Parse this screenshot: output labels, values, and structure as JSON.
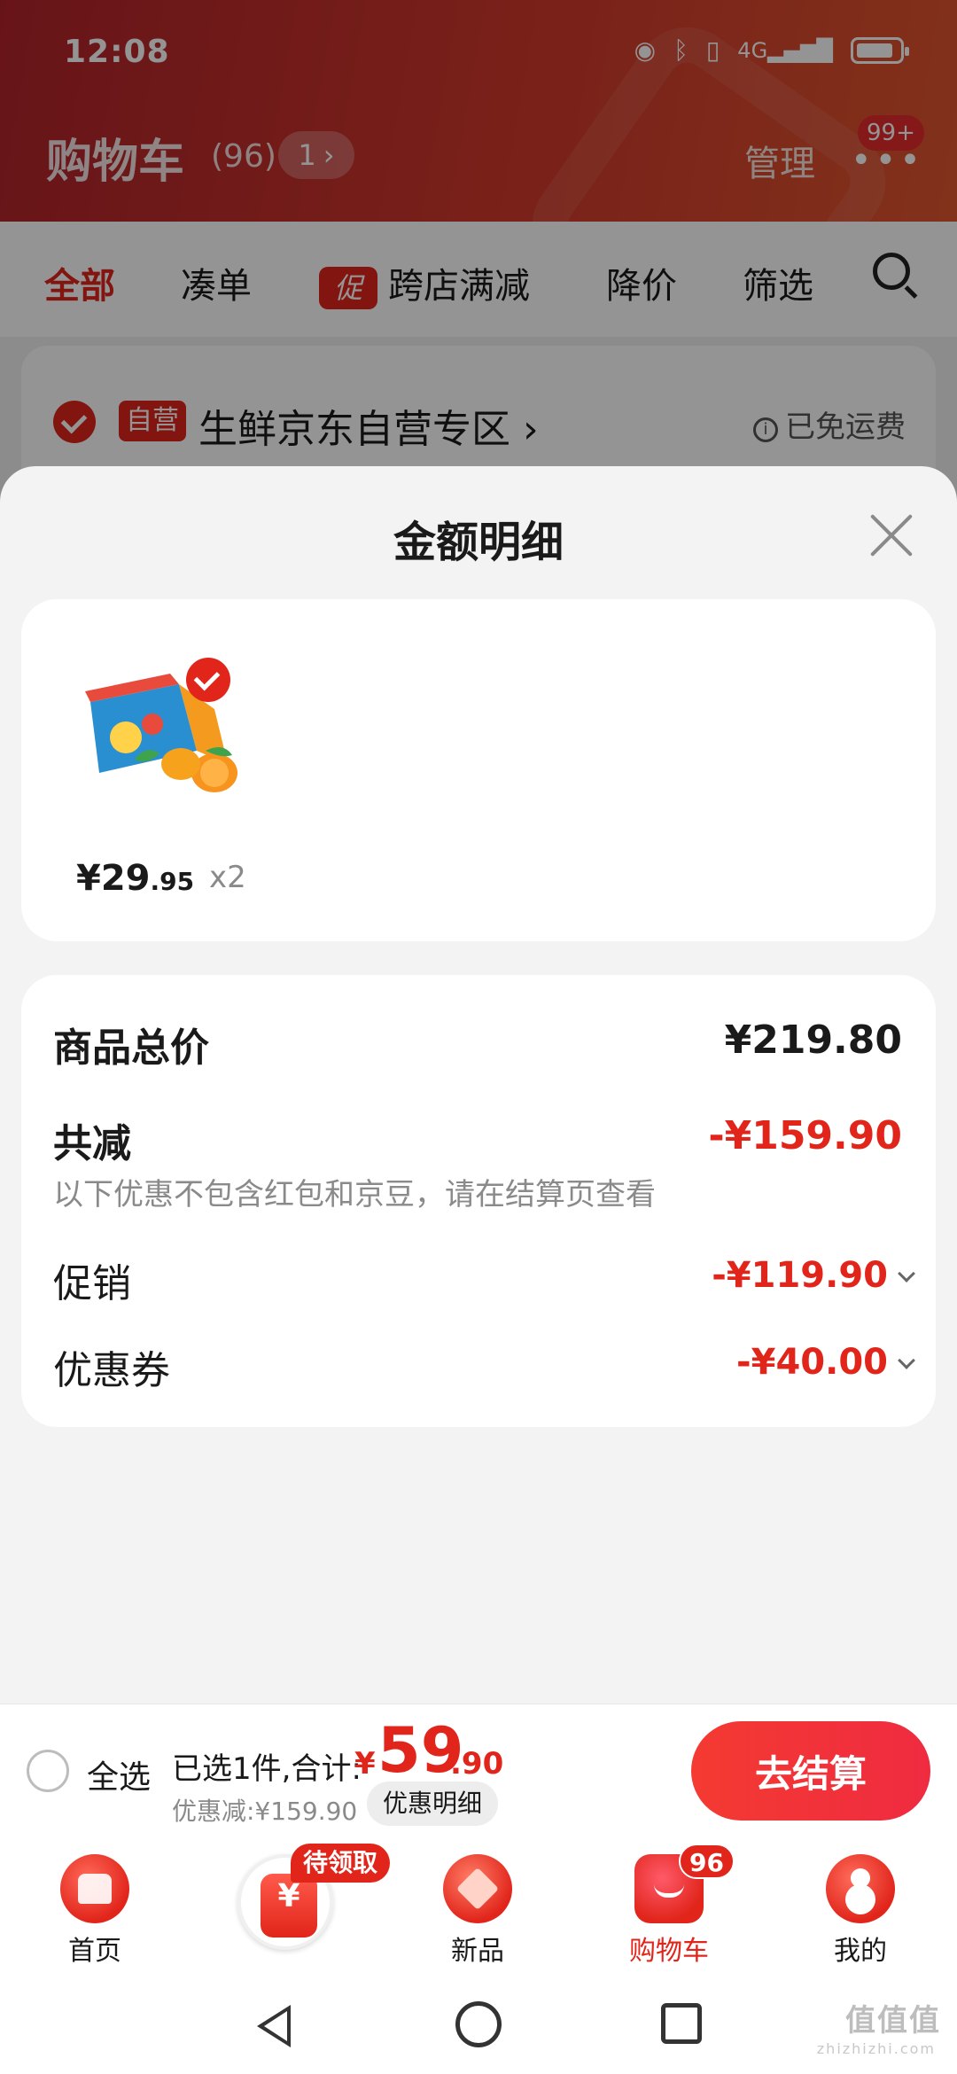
{
  "status_bar": {
    "time": "12:08",
    "icons": [
      "eye-icon",
      "bluetooth-icon",
      "vibrate-icon",
      "signal-4g-icon",
      "battery-icon"
    ]
  },
  "header": {
    "title": "购物车",
    "count": "(96)",
    "pill": "1",
    "manage": "管理",
    "more_badge": "99+"
  },
  "filters": [
    {
      "label": "全部",
      "active": true
    },
    {
      "label": "凑单"
    },
    {
      "label": "跨店满减",
      "tag": "促"
    },
    {
      "label": "降价"
    },
    {
      "label": "筛选"
    }
  ],
  "store": {
    "tag": "自营",
    "name": "生鲜京东自营专区",
    "shipping": "已免运费"
  },
  "sheet": {
    "title": "金额明细"
  },
  "product": {
    "price_int": "¥29",
    "price_dec": ".95",
    "qty": "x2"
  },
  "details": {
    "goods_total_label": "商品总价",
    "goods_total_value": "¥219.80",
    "reduce_label": "共减",
    "reduce_value": "-¥159.90",
    "note": "以下优惠不包含红包和京豆，请在结算页查看",
    "promo_label": "促销",
    "promo_value": "-¥119.90",
    "coupon_label": "优惠券",
    "coupon_value": "-¥40.00"
  },
  "checkout": {
    "select_all": "全选",
    "selected_text": "已选1件,合计:",
    "currency": "¥",
    "total_int": "59",
    "total_dec": ".90",
    "discount_text": "优惠减:¥159.90",
    "discount_detail_btn": "优惠明细",
    "checkout_btn": "去结算"
  },
  "tabbar": {
    "home": "首页",
    "coupon_badge": "待领取",
    "new": "新品",
    "cart": "购物车",
    "cart_badge": "96",
    "me": "我的"
  },
  "watermark": {
    "main": "值值值",
    "sub": "zhizhizhi.com"
  },
  "colors": {
    "accent": "#e1251b",
    "header_bg": "#c93028",
    "sheet_bg": "#f3f3f3"
  }
}
